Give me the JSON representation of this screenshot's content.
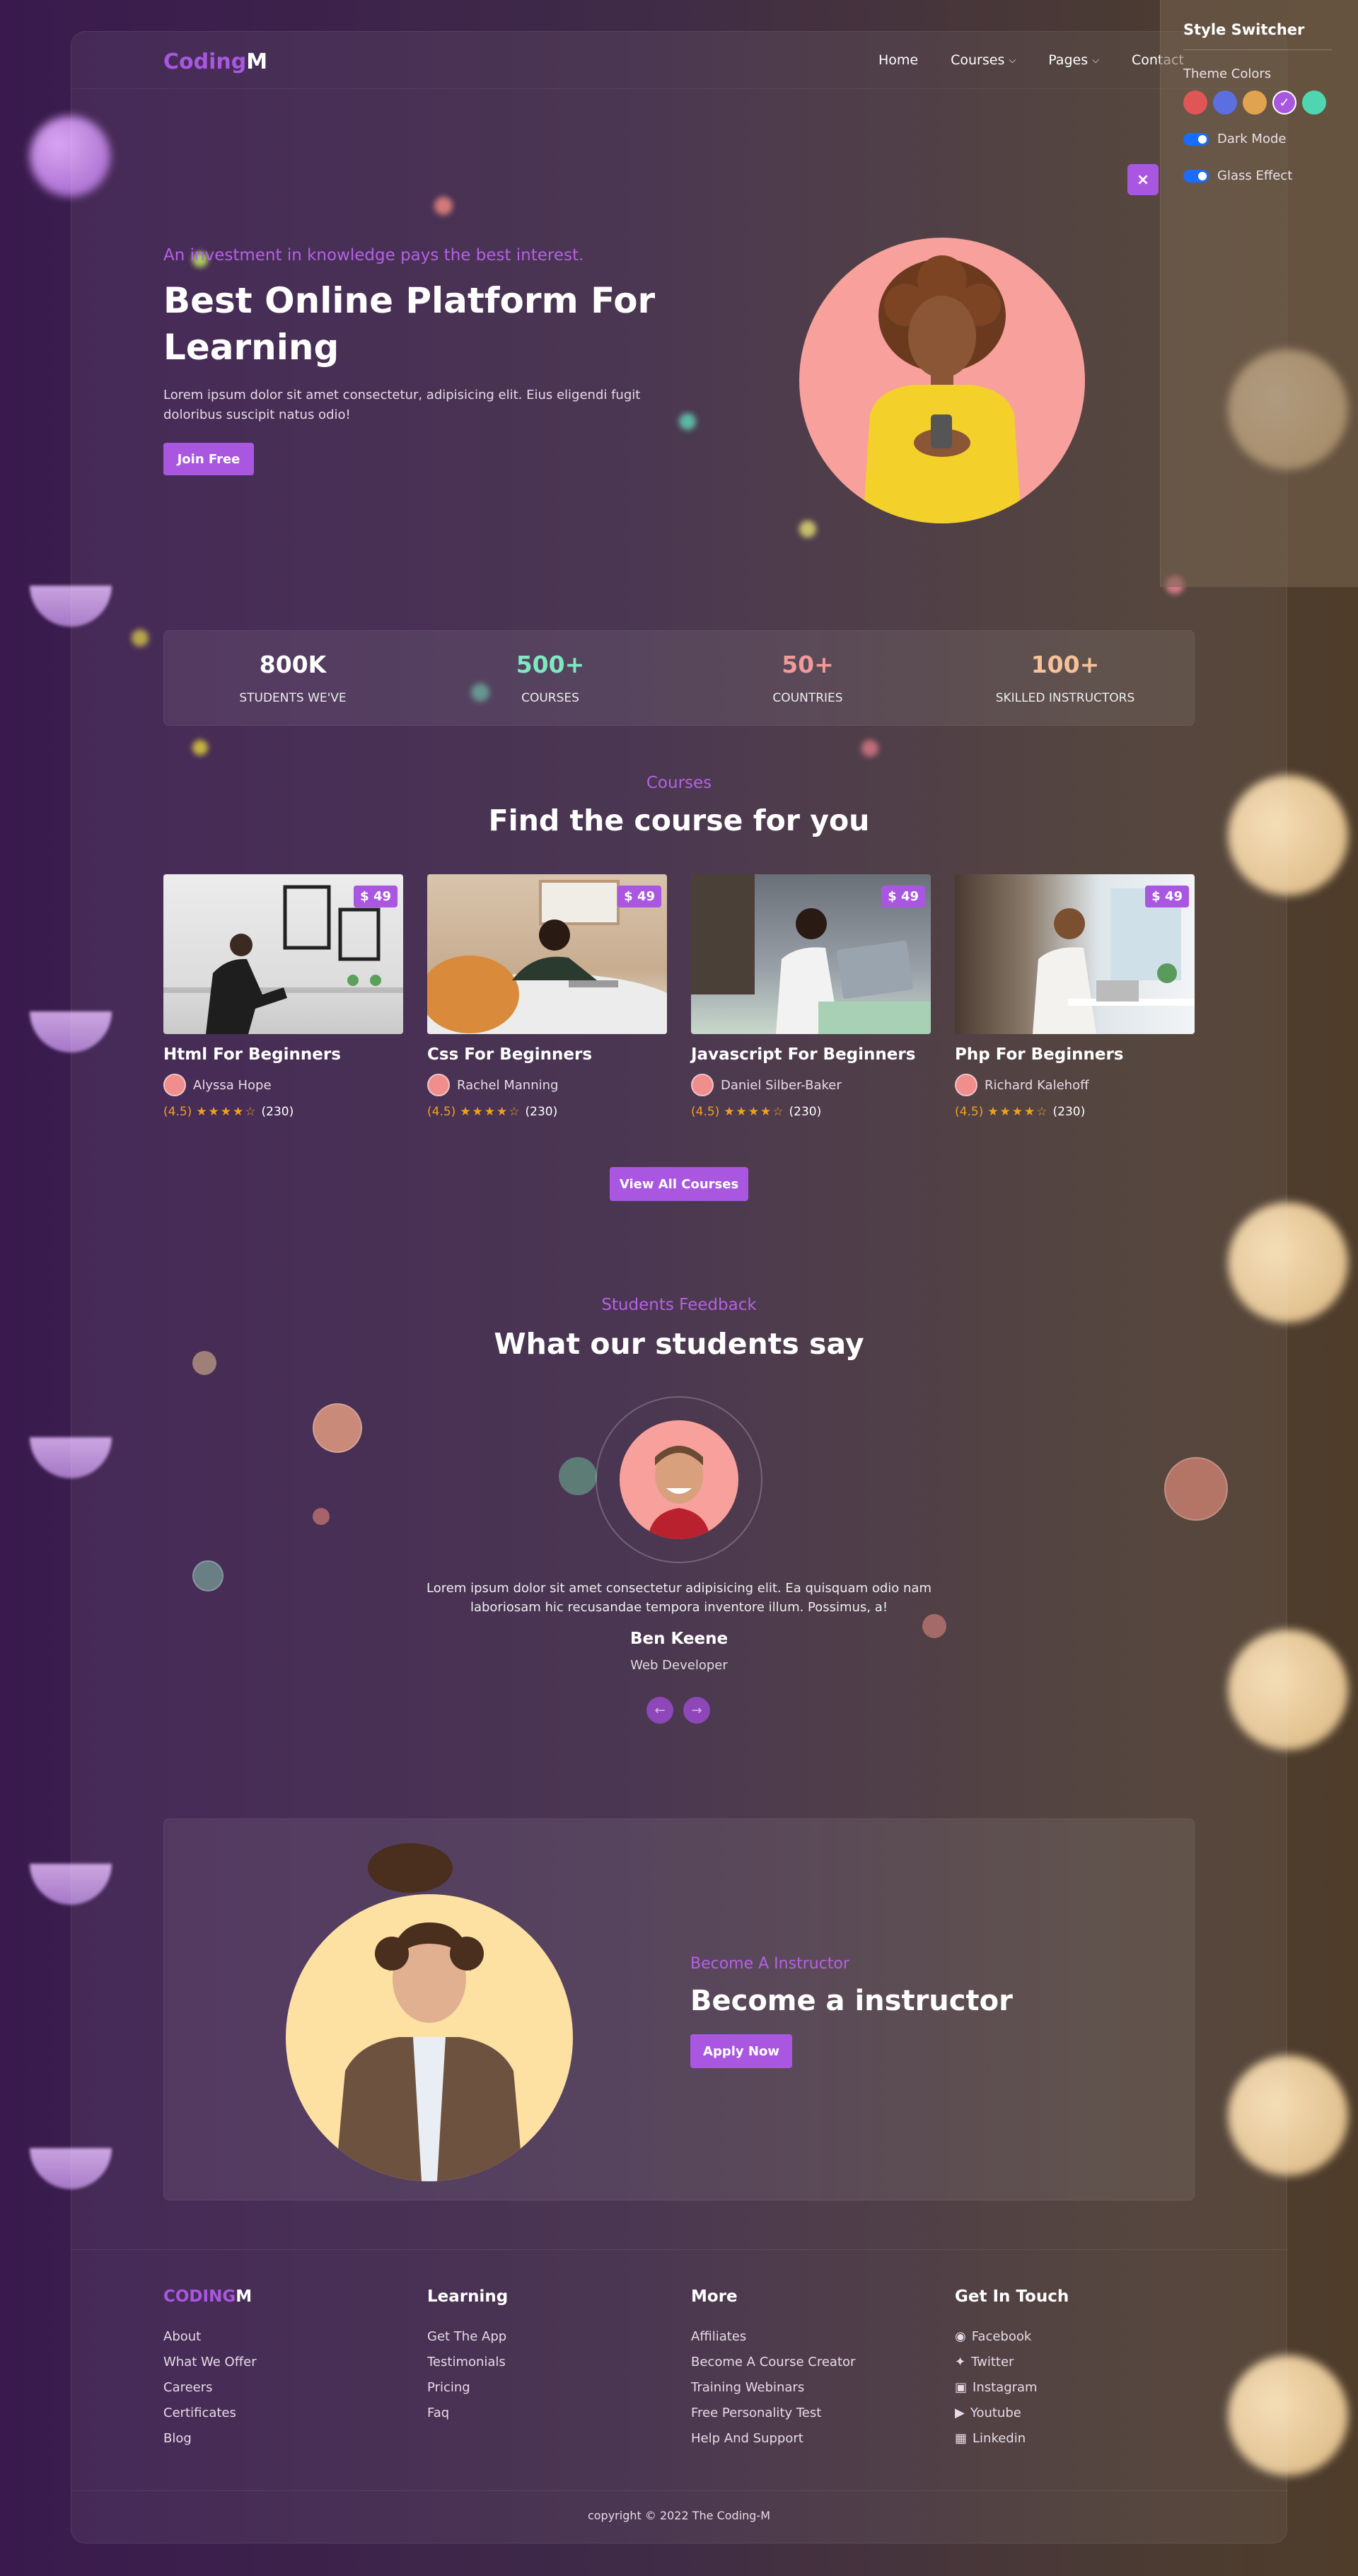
{
  "brand": {
    "name_accent": "Coding",
    "name_rest": "M"
  },
  "nav": {
    "items": [
      {
        "label": "Home",
        "dropdown": false
      },
      {
        "label": "Courses",
        "dropdown": true
      },
      {
        "label": "Pages",
        "dropdown": true
      },
      {
        "label": "Contact",
        "dropdown": false
      }
    ]
  },
  "switcher": {
    "title": "Style Switcher",
    "theme_label": "Theme Colors",
    "colors": [
      "#e05555",
      "#5b6fe0",
      "#e0a450",
      "#a957e0",
      "#4fd6b0"
    ],
    "selected_color": "#a957e0",
    "dark_mode_label": "Dark Mode",
    "glass_label": "Glass Effect",
    "close_icon": "×"
  },
  "hero": {
    "tag": "An investment in knowledge pays the best interest.",
    "title": "Best Online Platform For Learning",
    "text": "Lorem ipsum dolor sit amet consectetur, adipisicing elit. Eius eligendi fugit doloribus suscipit natus odio!",
    "button": "Join Free"
  },
  "stats": [
    {
      "value": "800K",
      "label": "STUDENTS WE'VE",
      "color": "#ffffff"
    },
    {
      "value": "500+",
      "label": "COURSES",
      "color": "#7ee8c0"
    },
    {
      "value": "50+",
      "label": "COUNTRIES",
      "color": "#f19a9a"
    },
    {
      "value": "100+",
      "label": "SKILLED INSTRUCTORS",
      "color": "#f5c29a"
    }
  ],
  "courses": {
    "tag": "Courses",
    "title": "Find the course for you",
    "items": [
      {
        "title": "Html For Beginners",
        "author": "Alyssa Hope",
        "price": "$ 49",
        "rating": "(4.5)",
        "reviews": "(230)"
      },
      {
        "title": "Css For Beginners",
        "author": "Rachel Manning",
        "price": "$ 49",
        "rating": "(4.5)",
        "reviews": "(230)"
      },
      {
        "title": "Javascript For Beginners",
        "author": "Daniel Silber-Baker",
        "price": "$ 49",
        "rating": "(4.5)",
        "reviews": "(230)"
      },
      {
        "title": "Php For Beginners",
        "author": "Richard Kalehoff",
        "price": "$ 49",
        "rating": "(4.5)",
        "reviews": "(230)"
      }
    ],
    "stars": "★★★★☆",
    "button": "View All Courses"
  },
  "feedback": {
    "tag": "Students Feedback",
    "title": "What our students say",
    "text": "Lorem ipsum dolor sit amet consectetur adipisicing elit. Ea quisquam odio nam laboriosam hic recusandae tempora inventore illum. Possimus, a!",
    "name": "Ben Keene",
    "role": "Web Developer",
    "prev": "←",
    "next": "→"
  },
  "instructor": {
    "tag": "Become A Instructor",
    "title": "Become a instructor",
    "button": "Apply Now"
  },
  "footer": {
    "brand_accent": "CODING",
    "brand_rest": "M",
    "brand_links": [
      "About",
      "What We Offer",
      "Careers",
      "Certificates",
      "Blog"
    ],
    "learning_title": "Learning",
    "learning_links": [
      "Get The App",
      "Testimonials",
      "Pricing",
      "Faq"
    ],
    "more_title": "More",
    "more_links": [
      "Affiliates",
      "Become A Course Creator",
      "Training Webinars",
      "Free Personality Test",
      "Help And Support"
    ],
    "touch_title": "Get In Touch",
    "touch_links": [
      {
        "label": "Facebook",
        "icon": "facebook-icon"
      },
      {
        "label": "Twitter",
        "icon": "twitter-icon"
      },
      {
        "label": "Instagram",
        "icon": "instagram-icon"
      },
      {
        "label": "Youtube",
        "icon": "youtube-icon"
      },
      {
        "label": "Linkedin",
        "icon": "linkedin-icon"
      }
    ],
    "copyright": "copyright © 2022 The Coding-M"
  }
}
